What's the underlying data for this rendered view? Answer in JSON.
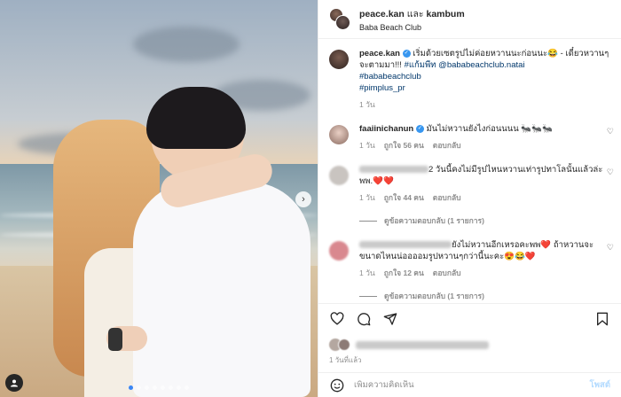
{
  "header": {
    "user1": "peace.kan",
    "and_word": " และ ",
    "user2": "kambum",
    "location": "Baba Beach Club"
  },
  "caption": {
    "username": "peace.kan",
    "text": " เริ่มด้วยเซตรูปไม่ค่อยหวานนะก่อนนะ😂 - เดี๋ยวหวานๆจะตามมา!!! ",
    "tag1": "#แก้มพีท",
    "mention": " @bababeachclub.natai",
    "tag2": "#bababeachclub",
    "tag3": "#pimplus_pr",
    "time": "1 วัน"
  },
  "comments": [
    {
      "username": "faaiinichanun",
      "text": " มันไม่หวานยังไงก่อนนนน 🐜🐜🐜",
      "time": "1 วัน",
      "likes": "ถูกใจ 56 คน",
      "reply": "ตอบกลับ"
    },
    {
      "username": "",
      "text": "2 วันนี้คงไม่มีรูปไหนหวานเท่ารูปทาโลนั้นแล้วล่ะพพ.❤️❤️",
      "time": "1 วัน",
      "likes": "ถูกใจ 44 คน",
      "reply": "ตอบกลับ",
      "view_replies": "ดูข้อความตอบกลับ (1 รายการ)"
    },
    {
      "username": "",
      "text": "ยังไม่หวานอีกเหรอคะพพ❤️ ถ้าหวานจะขนาดไหนน่ออออมรูปหวานๆกว่านี้นะคะ😍😂❤️",
      "time": "1 วัน",
      "likes": "ถูกใจ 12 คน",
      "reply": "ตอบกลับ",
      "view_replies": "ดูข้อความตอบกลับ (1 รายการ)"
    }
  ],
  "footer": {
    "time": "1 วันที่แล้ว",
    "add_comment_placeholder": "เพิ่มความคิดเห็น",
    "post_label": "โพสต์"
  },
  "icons": {
    "like": "heart-icon",
    "comment": "comment-icon",
    "share": "share-icon",
    "save": "bookmark-icon",
    "emoji": "emoji-icon",
    "next": "chevron-right-icon"
  },
  "colors": {
    "link": "#00376b",
    "verified": "#3897f0",
    "muted": "#8e8e8e",
    "active_dot": "#3a86f5"
  }
}
